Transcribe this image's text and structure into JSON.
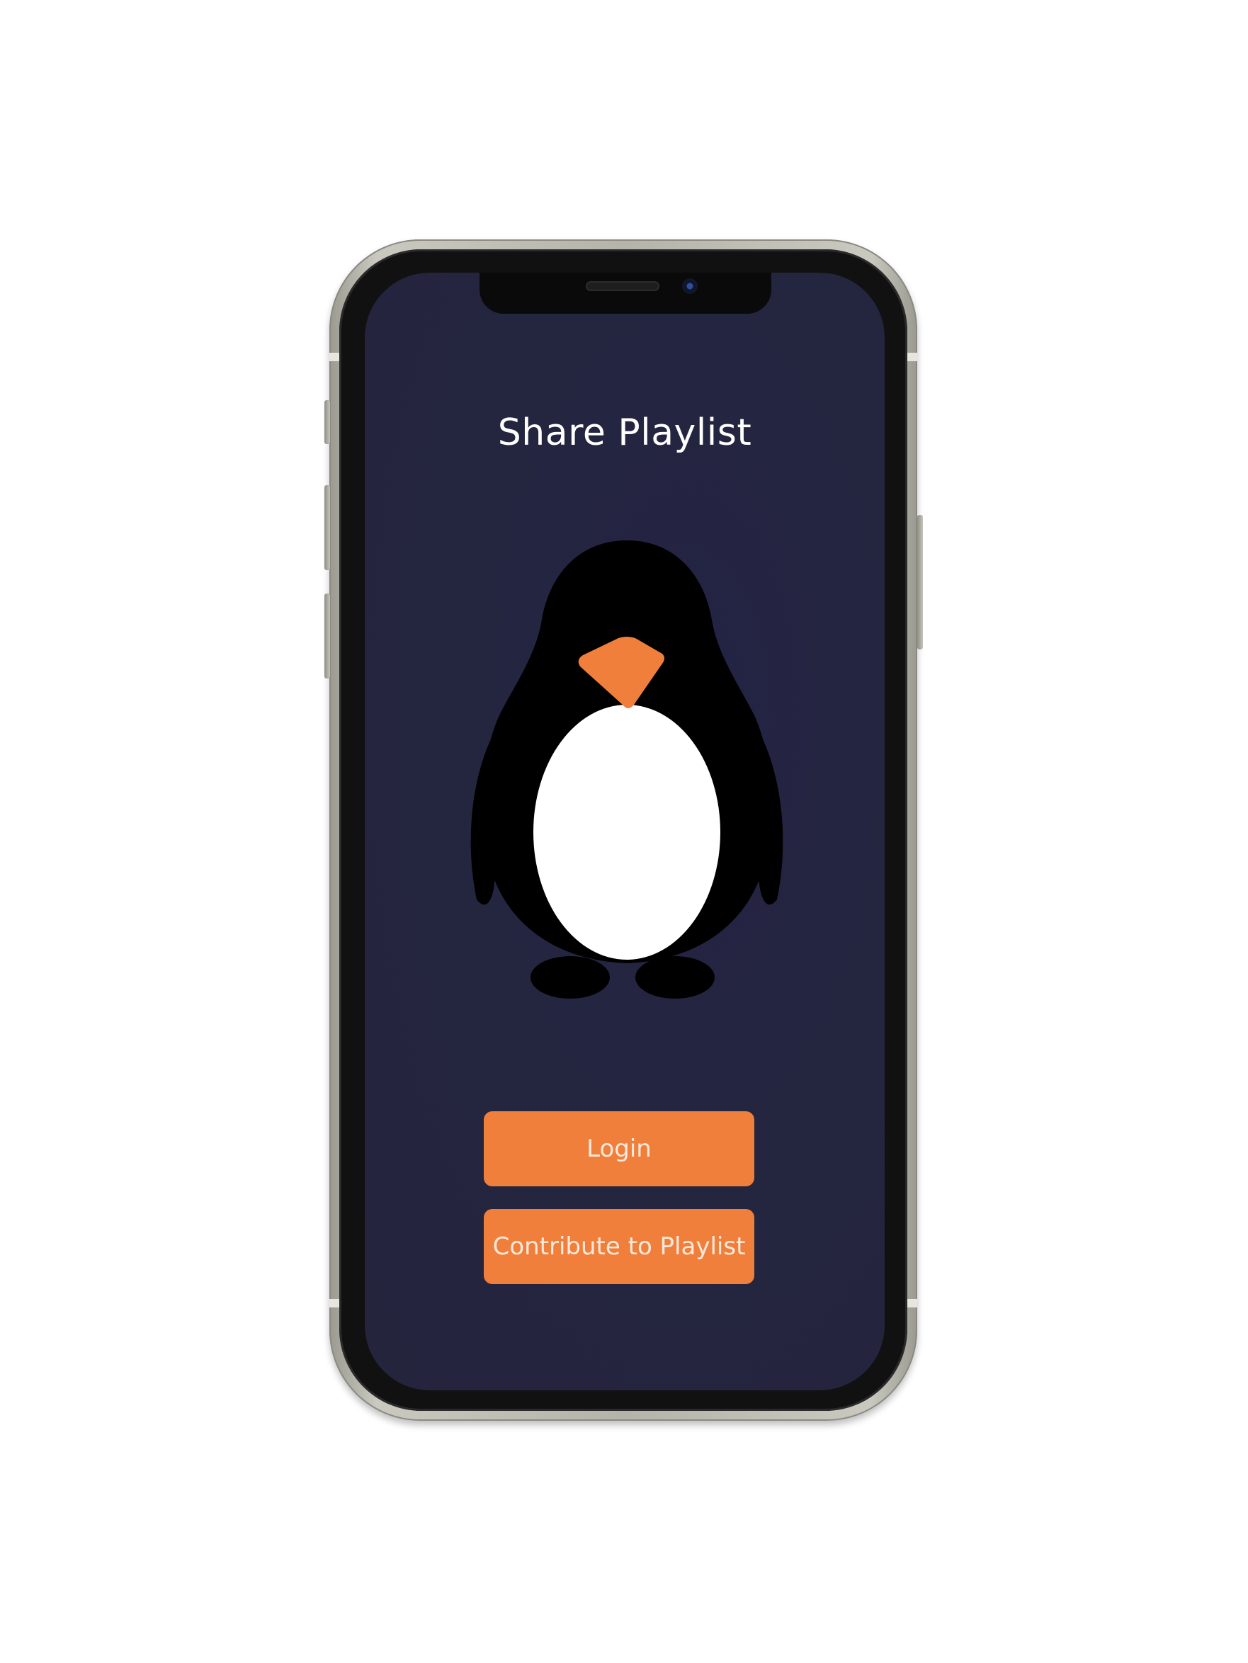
{
  "screen": {
    "title": "Share Playlist",
    "background_color": "#24253f"
  },
  "illustration": {
    "name": "penguin",
    "body_color": "#000000",
    "belly_color": "#ffffff",
    "beak_color": "#f07f3c"
  },
  "actions": {
    "login_label": "Login",
    "contribute_label": "Contribute to Playlist",
    "button_color": "#f07f3c"
  }
}
